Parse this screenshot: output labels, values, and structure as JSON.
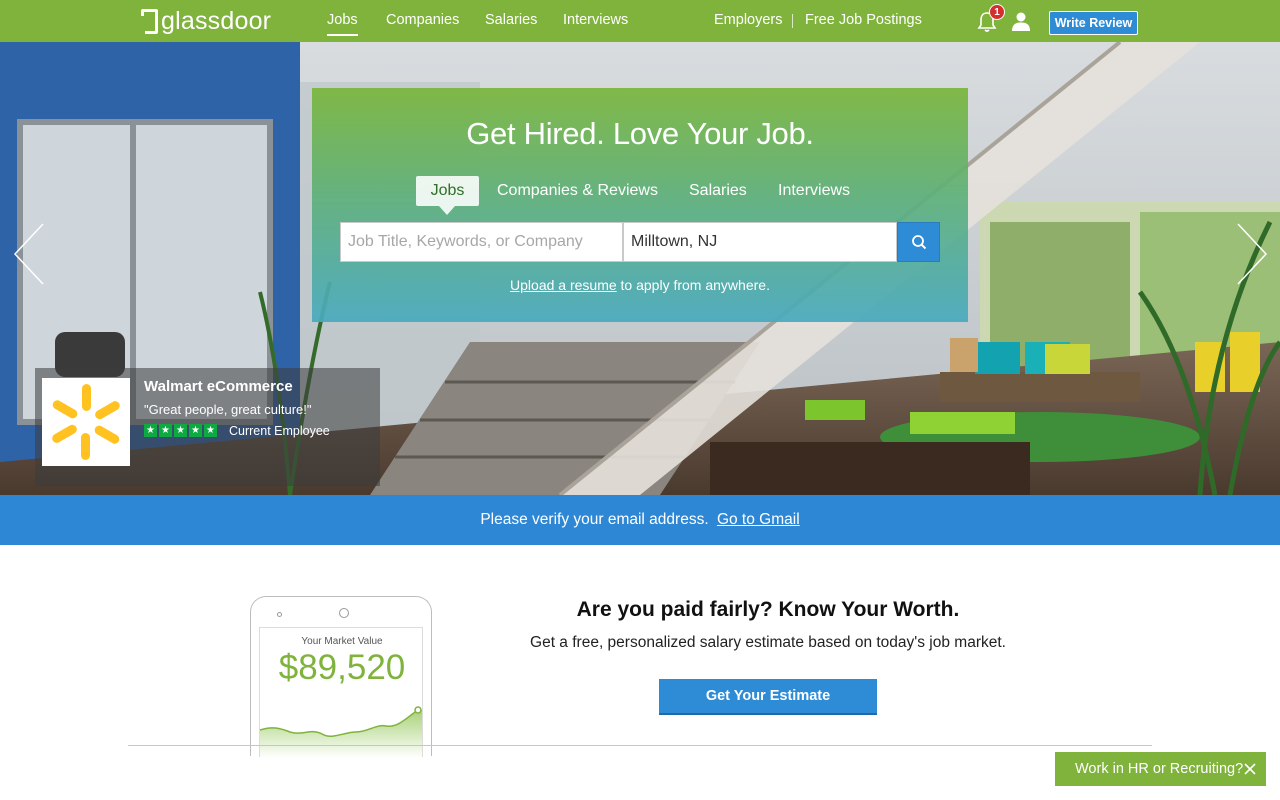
{
  "nav": {
    "logo_text": "glassdoor",
    "links": [
      "Jobs",
      "Companies",
      "Salaries",
      "Interviews"
    ],
    "employers": "Employers",
    "free_job_postings": "Free Job Postings",
    "notification_count": "1",
    "write_review": "Write Review"
  },
  "hero": {
    "headline": "Get Hired. Love Your Job.",
    "tabs": [
      "Jobs",
      "Companies & Reviews",
      "Salaries",
      "Interviews"
    ],
    "keyword_placeholder": "Job Title, Keywords, or Company",
    "location_value": "Milltown, NJ",
    "upload_link": "Upload a resume",
    "upload_rest": " to apply from anywhere."
  },
  "review_card": {
    "company": "Walmart eCommerce",
    "quote": "\"Great people, great culture!\"",
    "stars": 5,
    "role": "Current Employee",
    "brand_color": "#ffc220"
  },
  "verify_bar": {
    "text": "Please verify your email address.",
    "link": "Go to Gmail"
  },
  "salary_promo": {
    "market_value_label": "Your Market Value",
    "market_value": "$89,520",
    "title": "Are you paid fairly? Know Your Worth.",
    "subtitle": "Get a free, personalized salary estimate based on today's job market.",
    "button": "Get Your Estimate"
  },
  "hr_banner": {
    "text": "Work in HR or Recruiting?"
  },
  "colors": {
    "brand_green": "#7fb33c",
    "action_blue": "#2e8bd6",
    "verify_blue": "#2d87d5",
    "rating_green": "#0caa41"
  }
}
